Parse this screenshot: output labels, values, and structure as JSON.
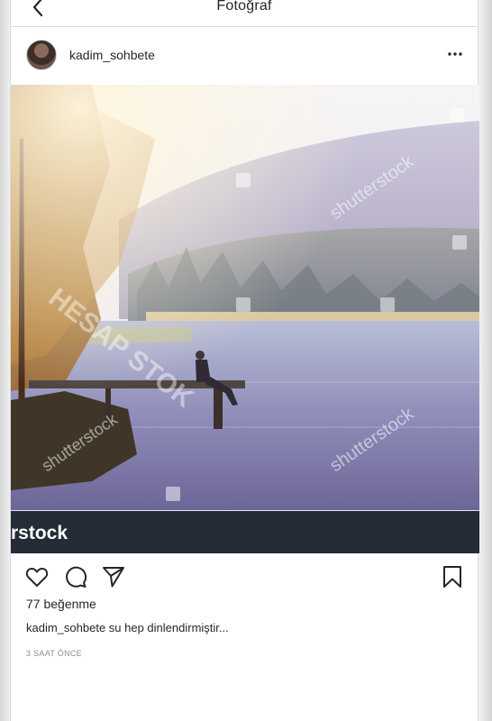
{
  "topbar": {
    "title": "Fotoğraf"
  },
  "post": {
    "username": "kadim_sohbete",
    "likes": "77 beğenme",
    "caption": "kadim_sohbete su hep dinlendirmiştir...",
    "time_ago": "3 SAAT ÖNCE"
  },
  "photo": {
    "watermark": "shutterstock",
    "watermark_strip": "rstock",
    "overlay_text": "HESAP STOK"
  },
  "icons": {
    "back": "chevron-left-icon",
    "more": "more-horizontal-icon",
    "like": "heart-icon",
    "comment": "comment-icon",
    "share": "send-icon",
    "save": "bookmark-icon"
  },
  "colors": {
    "text": "#262626",
    "muted": "#8e8e8e",
    "border": "#dbdbdb",
    "watermark_bar": "#242c37"
  }
}
